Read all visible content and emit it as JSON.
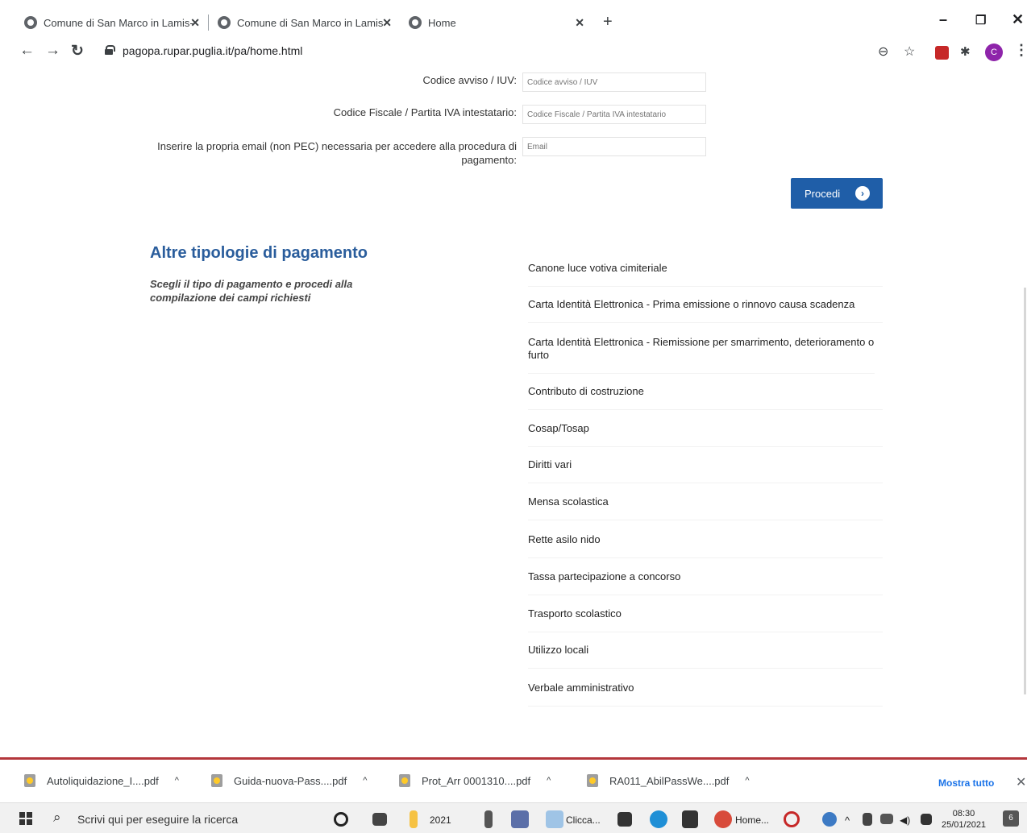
{
  "browser": {
    "tabs": [
      {
        "title": "Comune di San Marco in Lamis-"
      },
      {
        "title": "Comune di San Marco in Lamis"
      },
      {
        "title": "Home"
      }
    ],
    "url": "pagopa.rupar.puglia.it/pa/home.html",
    "profile_initial": "C"
  },
  "form": {
    "codice_avviso_label": "Codice avviso / IUV:",
    "codice_avviso_placeholder": "Codice avviso / IUV",
    "codice_fiscale_label": "Codice Fiscale / Partita IVA intestatario:",
    "codice_fiscale_placeholder": "Codice Fiscale / Partita IVA intestatario",
    "email_label_line1": "Inserire la propria email (non PEC) necessaria per accedere alla procedura di",
    "email_label_line2": "pagamento:",
    "email_placeholder": "Email",
    "submit_label": "Procedi"
  },
  "other_payments": {
    "title": "Altre tipologie di pagamento",
    "subtitle": "Scegli il tipo di pagamento e procedi alla compilazione dei campi richiesti",
    "items": [
      "Canone luce votiva cimiteriale",
      "Carta Identità Elettronica - Prima emissione o rinnovo causa scadenza",
      "Carta Identità Elettronica - Riemissione per smarrimento, deterioramento o furto",
      "Contributo di costruzione",
      "Cosap/Tosap",
      "Diritti vari",
      "Mensa scolastica",
      "Rette asilo nido",
      "Tassa partecipazione a concorso",
      "Trasporto scolastico",
      "Utilizzo locali",
      "Verbale amministrativo"
    ]
  },
  "downloads": {
    "items": [
      "Autoliquidazione_I....pdf",
      "Guida-nuova-Pass....pdf",
      "Prot_Arr 0001310....pdf",
      "RA011_AbilPassWe....pdf"
    ],
    "show_all": "Mostra tutto"
  },
  "taskbar": {
    "search_placeholder": "Scrivi qui per eseguire la ricerca",
    "folder_label": "2021",
    "app1_label": "Clicca...",
    "app2_label": "Home...",
    "time": "08:30",
    "date": "25/01/2021",
    "notifications": "6"
  },
  "colors": {
    "primary_blue": "#1f5ea8",
    "title_blue": "#2a5d9c",
    "download_bar_accent": "#b3363b"
  }
}
